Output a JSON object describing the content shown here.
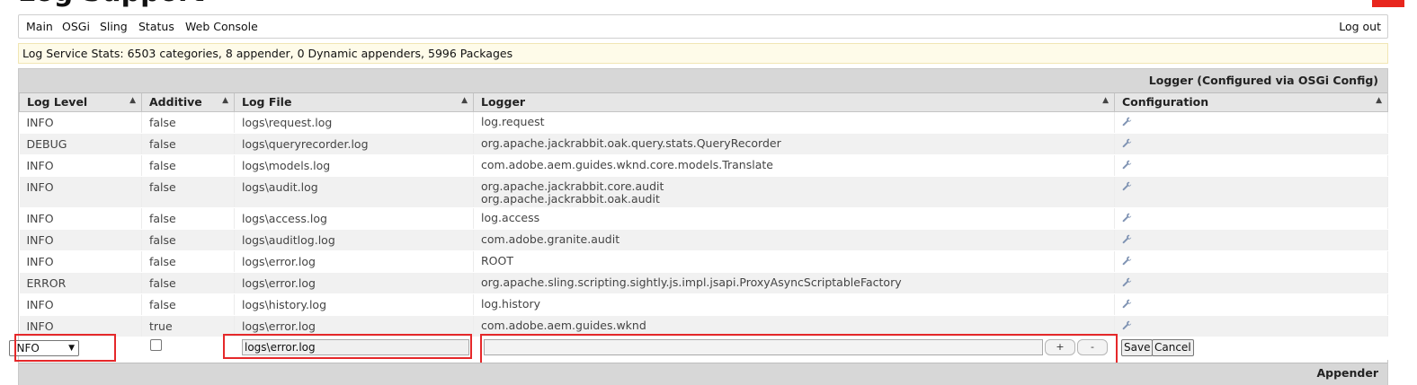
{
  "page": {
    "title": "Log Support"
  },
  "nav": {
    "items": [
      "Main",
      "OSGi",
      "Sling",
      "Status",
      "Web Console"
    ],
    "logout": "Log out"
  },
  "stats": "Log Service Stats: 6503 categories, 8 appender, 0 Dynamic appenders, 5996 Packages",
  "logger_panel": {
    "title": "Logger (Configured via OSGi Config)",
    "columns": [
      "Log Level",
      "Additive",
      "Log File",
      "Logger",
      "Configuration"
    ],
    "rows": [
      {
        "level": "INFO",
        "additive": "false",
        "file": "logs\\request.log",
        "loggers": [
          "log.request"
        ]
      },
      {
        "level": "DEBUG",
        "additive": "false",
        "file": "logs\\queryrecorder.log",
        "loggers": [
          "org.apache.jackrabbit.oak.query.stats.QueryRecorder"
        ]
      },
      {
        "level": "INFO",
        "additive": "false",
        "file": "logs\\models.log",
        "loggers": [
          "com.adobe.aem.guides.wknd.core.models.Translate"
        ]
      },
      {
        "level": "INFO",
        "additive": "false",
        "file": "logs\\audit.log",
        "loggers": [
          "org.apache.jackrabbit.core.audit",
          "org.apache.jackrabbit.oak.audit"
        ]
      },
      {
        "level": "INFO",
        "additive": "false",
        "file": "logs\\access.log",
        "loggers": [
          "log.access"
        ]
      },
      {
        "level": "INFO",
        "additive": "false",
        "file": "logs\\auditlog.log",
        "loggers": [
          "com.adobe.granite.audit"
        ]
      },
      {
        "level": "INFO",
        "additive": "false",
        "file": "logs\\error.log",
        "loggers": [
          "ROOT"
        ]
      },
      {
        "level": "ERROR",
        "additive": "false",
        "file": "logs\\error.log",
        "loggers": [
          "org.apache.sling.scripting.sightly.js.impl.jsapi.ProxyAsyncScriptableFactory"
        ]
      },
      {
        "level": "INFO",
        "additive": "false",
        "file": "logs\\history.log",
        "loggers": [
          "log.history"
        ]
      },
      {
        "level": "INFO",
        "additive": "true",
        "file": "logs\\error.log",
        "loggers": [
          "com.adobe.aem.guides.wknd"
        ]
      }
    ],
    "edit_row": {
      "level_value": "INFO",
      "file_value": "logs\\error.log",
      "logger_value": "",
      "plus_label": "+",
      "minus_label": "-",
      "save_label": "Save",
      "cancel_label": "Cancel"
    }
  },
  "appender_panel": {
    "title": "Appender"
  },
  "icons": {
    "sort": "sort-updown-icon",
    "config": "wrench-icon",
    "select": "chevron-down-icon"
  },
  "colors": {
    "highlight": "#e5282a",
    "brand": "#e8261d",
    "stats_bg": "#fefbe9"
  }
}
